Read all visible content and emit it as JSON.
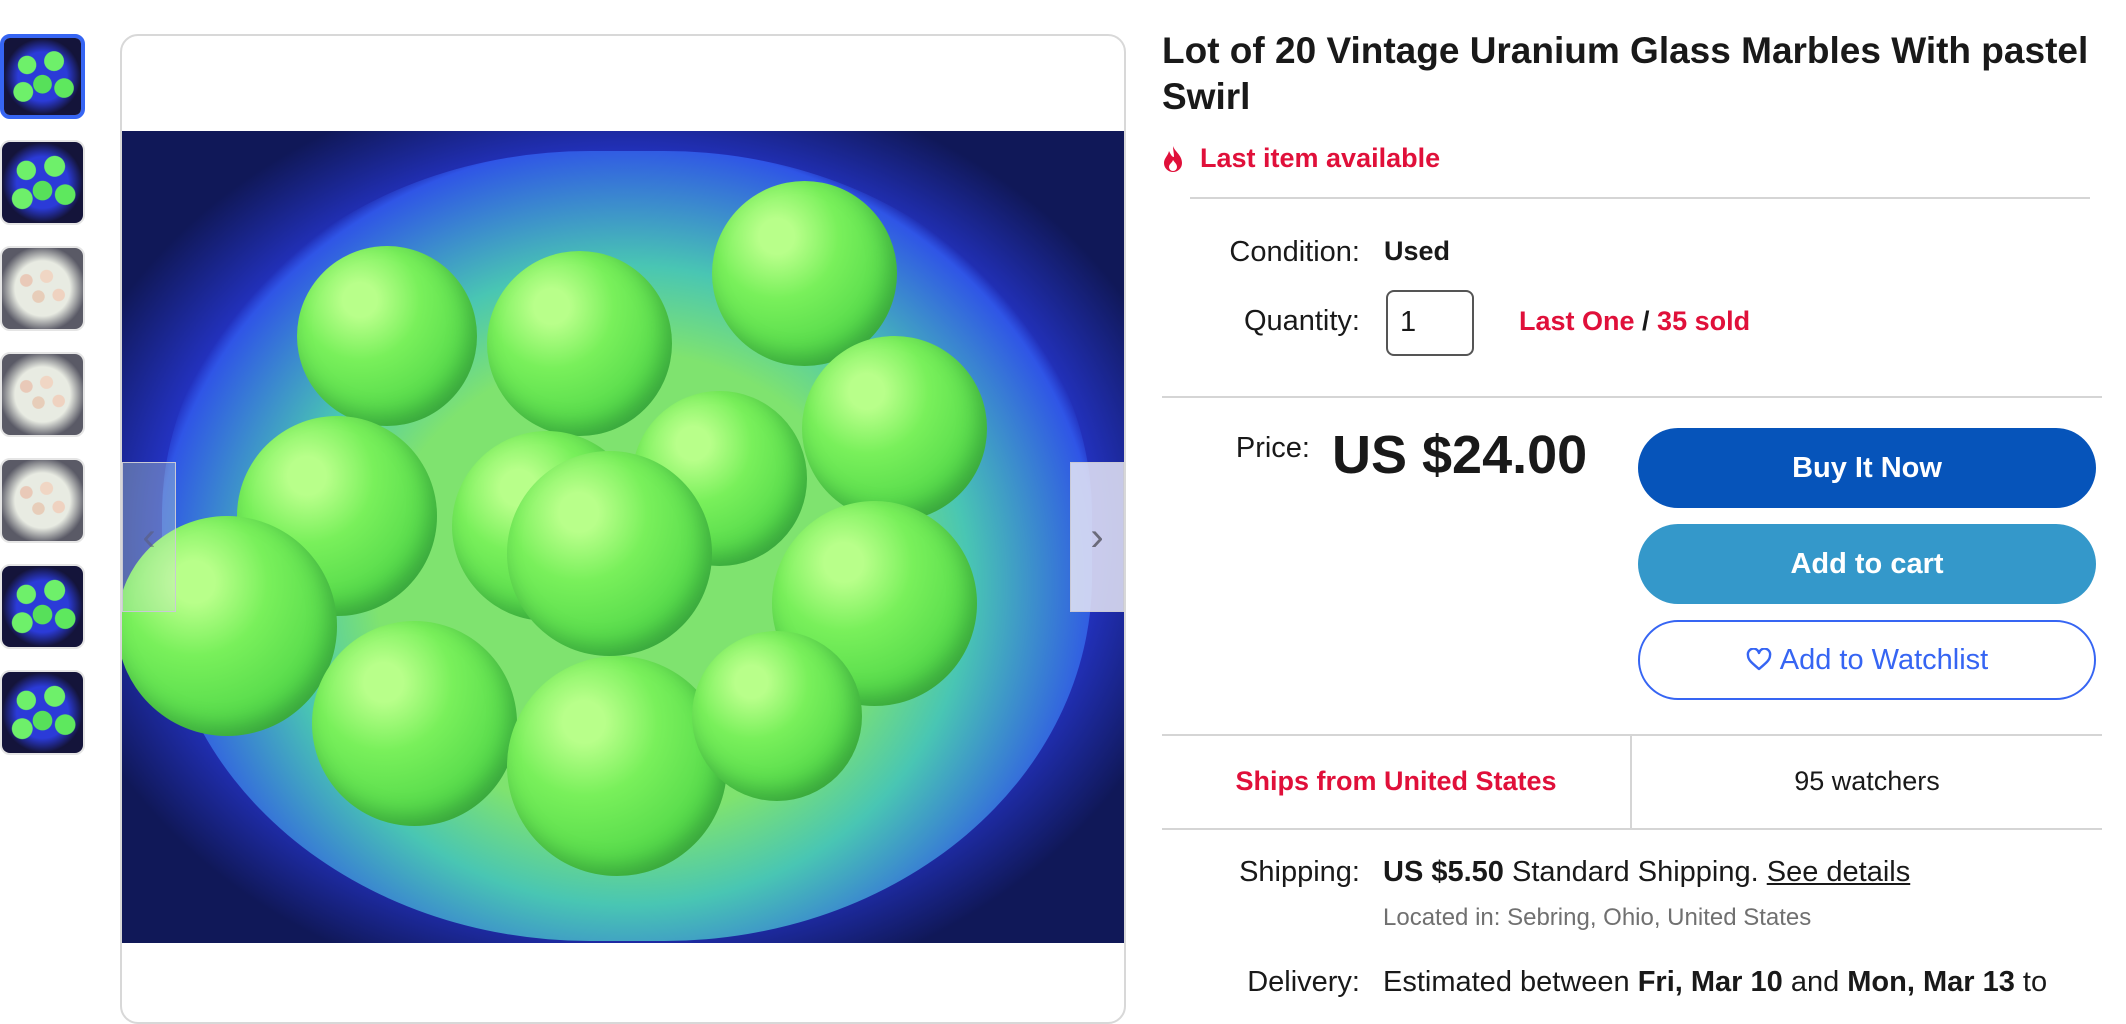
{
  "gallery": {
    "thumbnails": [
      {
        "alt": "uv-glow-photo-1",
        "style": "uv"
      },
      {
        "alt": "uv-glow-photo-2",
        "style": "uv"
      },
      {
        "alt": "daylight-photo-1",
        "style": "white"
      },
      {
        "alt": "daylight-photo-2",
        "style": "white"
      },
      {
        "alt": "daylight-photo-3",
        "style": "white"
      },
      {
        "alt": "uv-glow-photo-3",
        "style": "uv"
      },
      {
        "alt": "uv-glow-photo-4",
        "style": "uv"
      }
    ],
    "prev_icon": "chevron-left-icon",
    "next_icon": "chevron-right-icon",
    "prev_glyph": "‹",
    "next_glyph": "›"
  },
  "item": {
    "title": "Lot of 20 Vintage Uranium Glass Marbles With pastel Swirl",
    "urgency": "Last item available",
    "condition_label": "Condition:",
    "condition_value": "Used",
    "quantity_label": "Quantity:",
    "quantity_value": "1",
    "last_one": "Last One",
    "slash": " / ",
    "sold": "35 sold",
    "price_label": "Price:",
    "price": "US $24.00"
  },
  "actions": {
    "buy_now": "Buy It Now",
    "add_to_cart": "Add to cart",
    "watchlist": "Add to Watchlist"
  },
  "info": {
    "ships_from": "Ships from United States",
    "watchers": "95 watchers",
    "shipping_label": "Shipping:",
    "shipping_price": "US $5.50",
    "shipping_method": " Standard Shipping. ",
    "see_details": "See details",
    "located": "Located in: Sebring, Ohio, United States",
    "delivery_label": "Delivery:",
    "delivery_prefix": "Estimated between ",
    "delivery_start": "Fri, Mar 10",
    "delivery_mid": " and ",
    "delivery_end": "Mon, Mar 13",
    "delivery_suffix": " to"
  },
  "colors": {
    "accent_blue": "#3665f3",
    "buy_blue": "#0654ba",
    "cart_blue": "#3498ca",
    "alert_red": "#e0103a"
  }
}
